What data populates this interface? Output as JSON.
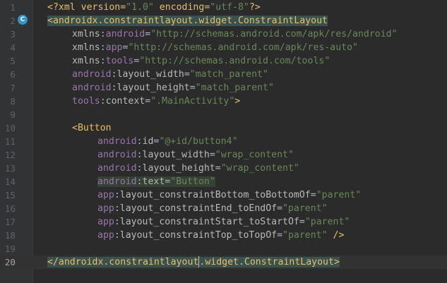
{
  "editor": {
    "gutter_badge": "C",
    "current_line": "20",
    "lines": [
      {
        "n": "1",
        "t1": "<?xml version=",
        "t2": "\"1.0\"",
        "t3": " encoding=",
        "t4": "\"utf-8\"",
        "t5": "?>"
      },
      {
        "n": "2",
        "tag": "<androidx.constraintlayout.widget.ConstraintLayout"
      },
      {
        "n": "3",
        "p": "xmlns",
        "c": ":",
        "a": "android",
        "e": "=",
        "v": "\"http://schemas.android.com/apk/res/android\""
      },
      {
        "n": "4",
        "p": "xmlns",
        "c": ":",
        "a": "app",
        "e": "=",
        "v": "\"http://schemas.android.com/apk/res-auto\""
      },
      {
        "n": "5",
        "p": "xmlns",
        "c": ":",
        "a": "tools",
        "e": "=",
        "v": "\"http://schemas.android.com/tools\""
      },
      {
        "n": "6",
        "p": "android",
        "c": ":",
        "a": "layout_width",
        "e": "=",
        "v": "\"match_parent\""
      },
      {
        "n": "7",
        "p": "android",
        "c": ":",
        "a": "layout_height",
        "e": "=",
        "v": "\"match_parent\""
      },
      {
        "n": "8",
        "p": "tools",
        "c": ":",
        "a": "context",
        "e": "=",
        "v": "\".MainActivity\"",
        "end": ">"
      },
      {
        "n": "9"
      },
      {
        "n": "10",
        "tag": "<Button"
      },
      {
        "n": "11",
        "p": "android",
        "c": ":",
        "a": "id",
        "e": "=",
        "v": "\"@+id/button4\""
      },
      {
        "n": "12",
        "p": "android",
        "c": ":",
        "a": "layout_width",
        "e": "=",
        "v": "\"wrap_content\""
      },
      {
        "n": "13",
        "p": "android",
        "c": ":",
        "a": "layout_height",
        "e": "=",
        "v": "\"wrap_content\""
      },
      {
        "n": "14",
        "p": "android",
        "c": ":",
        "a": "text",
        "e": "=",
        "v": "\"Button\""
      },
      {
        "n": "15",
        "p": "app",
        "c": ":",
        "a": "layout_constraintBottom_toBottomOf",
        "e": "=",
        "v": "\"parent\""
      },
      {
        "n": "16",
        "p": "app",
        "c": ":",
        "a": "layout_constraintEnd_toEndOf",
        "e": "=",
        "v": "\"parent\""
      },
      {
        "n": "17",
        "p": "app",
        "c": ":",
        "a": "layout_constraintStart_toStartOf",
        "e": "=",
        "v": "\"parent\""
      },
      {
        "n": "18",
        "p": "app",
        "c": ":",
        "a": "layout_constraintTop_toTopOf",
        "e": "=",
        "v": "\"parent\"",
        "end": " />"
      },
      {
        "n": "19"
      },
      {
        "n": "20",
        "tag_a": "</androidx.constraintlayout",
        "tag_b": ".widget.ConstraintLayout",
        "tag_end": ">"
      }
    ]
  },
  "colors": {
    "background": "#2b2b2b",
    "gutter": "#313335",
    "tag": "#e8bf6a",
    "namespace": "#9876aa",
    "attribute": "#bababa",
    "string": "#6a8759",
    "badge": "#3592c4"
  }
}
